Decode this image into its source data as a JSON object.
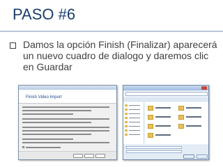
{
  "slide": {
    "title": "PASO #6",
    "bullet_text": "Damos la opción Finish (Finalizar) aparecerá un nuevo cuadro de dialogo y daremos clic en Guardar"
  },
  "screenshot1": {
    "dialog_title": "Finish Video Import"
  },
  "colors": {
    "title": "#1c3d6b",
    "body_text": "#404040",
    "rule": "#b9c7d9"
  }
}
